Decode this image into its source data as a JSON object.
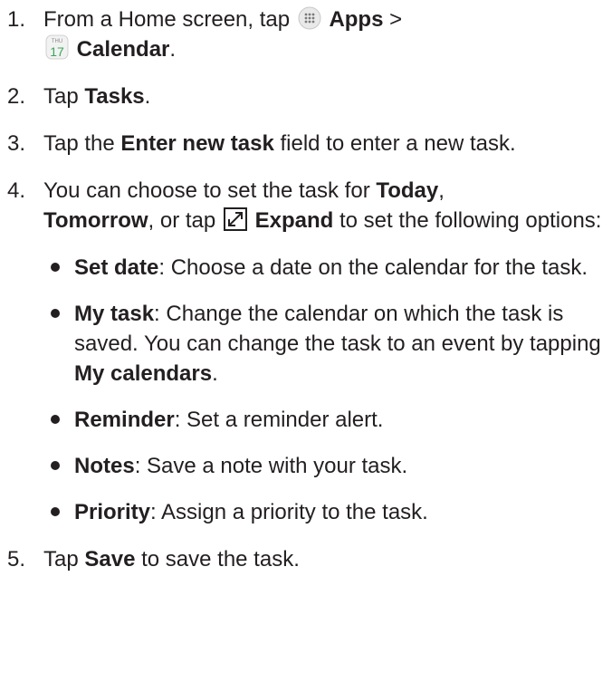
{
  "steps": [
    {
      "number": "1.",
      "t1": "From a Home screen, tap ",
      "apps": "Apps",
      "t2": " >",
      "calendar_icon_day": "THU",
      "calendar_icon_date": "17",
      "calendar": "Calendar",
      "t3": "."
    },
    {
      "number": "2.",
      "t1": "Tap ",
      "b1": "Tasks",
      "t2": "."
    },
    {
      "number": "3.",
      "t1": "Tap the ",
      "b1": "Enter new task",
      "t2": " field to enter a new task."
    },
    {
      "number": "4.",
      "t1": "You can choose to set the task for ",
      "b1": "Today",
      "t2": ",",
      "b2": "Tomorrow",
      "t3": ", or tap ",
      "b3": "Expand",
      "t4": " to set the following options:",
      "bullets": [
        {
          "label": "Set date",
          "text": ": Choose a date on the calendar for the task."
        },
        {
          "label": "My task",
          "text": ": Change the calendar on which the task is saved. You can change the task to an event by tapping ",
          "label2": "My calendars",
          "text2": "."
        },
        {
          "label": "Reminder",
          "text": ": Set a reminder alert."
        },
        {
          "label": "Notes",
          "text": ": Save a note with your task."
        },
        {
          "label": "Priority",
          "text": ": Assign a priority to the task."
        }
      ]
    },
    {
      "number": "5.",
      "t1": "Tap ",
      "b1": "Save",
      "t2": " to save the task."
    }
  ]
}
